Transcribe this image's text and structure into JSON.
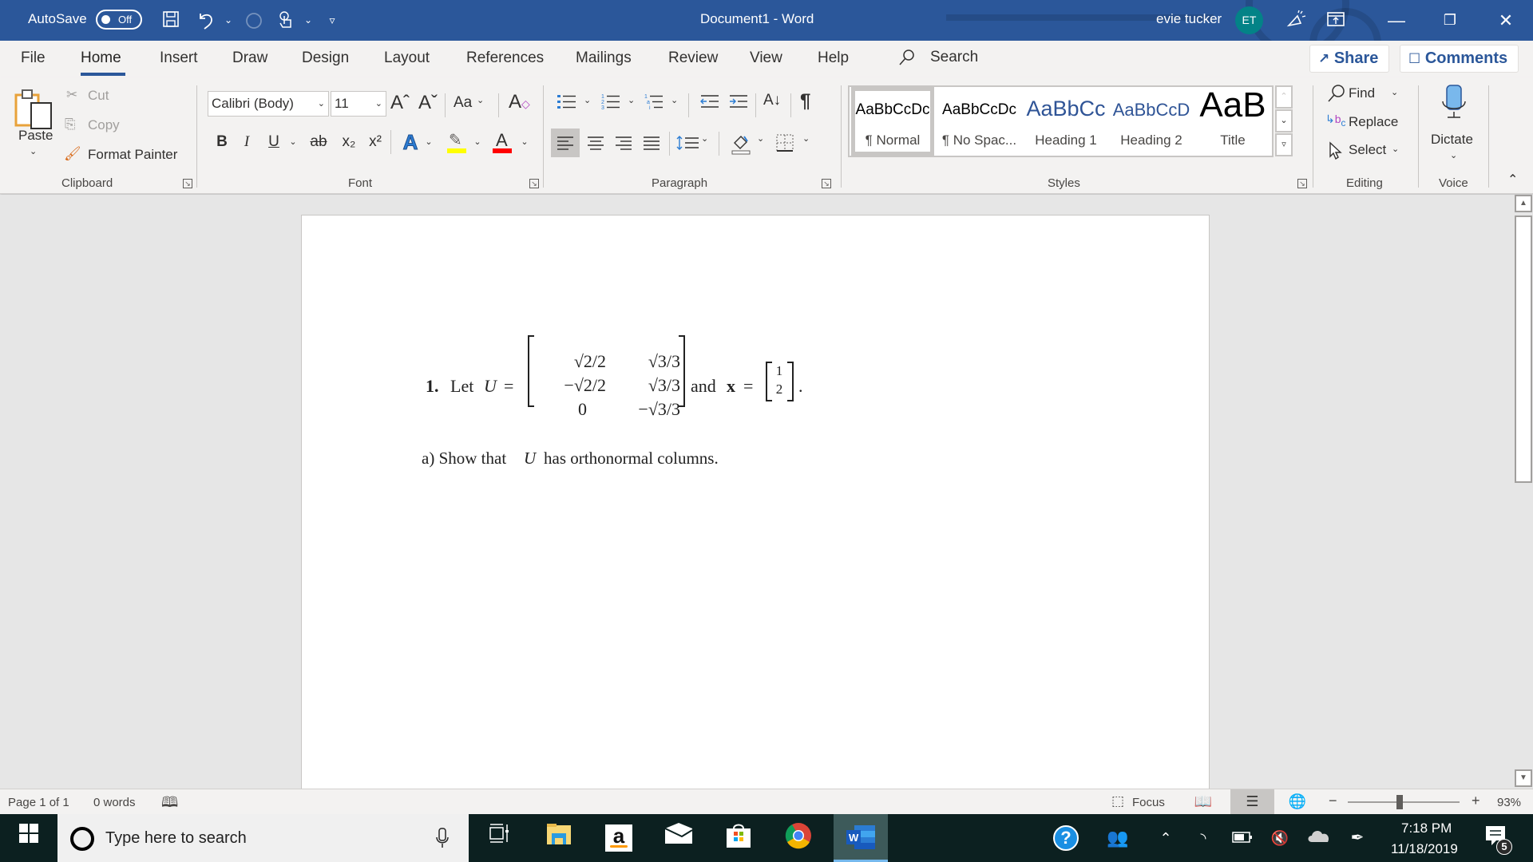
{
  "titlebar": {
    "autosave_label": "AutoSave",
    "autosave_state": "Off",
    "document_title": "Document1  -  Word",
    "user_name": "evie tucker",
    "user_initials": "ET",
    "icons": [
      "save-icon",
      "undo-icon",
      "redo-icon",
      "touch-mode-icon",
      "customize-qat-icon",
      "feedback-icon",
      "ribbon-display-icon",
      "minimize-icon",
      "restore-icon",
      "close-icon"
    ]
  },
  "tabs": {
    "items": [
      "File",
      "Home",
      "Insert",
      "Draw",
      "Design",
      "Layout",
      "References",
      "Mailings",
      "Review",
      "View",
      "Help"
    ],
    "active": "Home",
    "search_label": "Search",
    "share_label": "Share",
    "comments_label": "Comments"
  },
  "ribbon": {
    "clipboard": {
      "label": "Clipboard",
      "paste": "Paste",
      "cut": "Cut",
      "copy": "Copy",
      "format_painter": "Format Painter"
    },
    "font": {
      "label": "Font",
      "font_name": "Calibri (Body)",
      "font_size": "11",
      "grow": "Aˆ",
      "shrink": "Aˇ",
      "change_case": "Aa",
      "bold": "B",
      "italic": "I",
      "underline": "U",
      "strikethrough": "ab",
      "subscript": "x₂",
      "superscript": "x²",
      "text_effects": "A",
      "font_color": "A",
      "highlight_color": "#ffff00",
      "font_color_value": "#ff0000"
    },
    "paragraph": {
      "label": "Paragraph",
      "pilcrow": "¶",
      "sort": "A↓"
    },
    "styles": {
      "label": "Styles",
      "items": [
        {
          "sample": "AaBbCcDc",
          "name": "¶ Normal",
          "selected": true
        },
        {
          "sample": "AaBbCcDc",
          "name": "¶ No Spac...",
          "selected": false
        },
        {
          "sample": "AaBbCc",
          "name": "Heading 1",
          "selected": false
        },
        {
          "sample": "AaBbCcD",
          "name": "Heading 2",
          "selected": false
        },
        {
          "sample": "AaB",
          "name": "Title",
          "selected": false
        }
      ],
      "heading_color": "#2f5496"
    },
    "editing": {
      "label": "Editing",
      "find": "Find",
      "replace": "Replace",
      "select": "Select"
    },
    "voice": {
      "label": "Voice",
      "dictate": "Dictate"
    }
  },
  "document": {
    "problem_number": "1.",
    "let_text": "Let",
    "U": "U",
    "equals": "=",
    "matrix_U": [
      [
        "√2/2",
        "√3/3"
      ],
      [
        "−√2/2",
        "√3/3"
      ],
      [
        "0",
        "−√3/3"
      ]
    ],
    "and_text": "and",
    "x": "x",
    "vector_x": [
      "1",
      "2"
    ],
    "period": ".",
    "part_a": "a) Show that",
    "part_a_var": "U",
    "part_a_rest": "has orthonormal columns."
  },
  "statusbar": {
    "page": "Page 1 of 1",
    "words": "0 words",
    "focus": "Focus",
    "zoom": "93%",
    "zoom_level_percent": 93
  },
  "taskbar": {
    "search_placeholder": "Type here to search",
    "time": "7:18 PM",
    "date": "11/18/2019",
    "notifications": "5",
    "apps": [
      "task-view",
      "file-explorer",
      "amazon",
      "mail",
      "store",
      "chrome",
      "word"
    ]
  }
}
